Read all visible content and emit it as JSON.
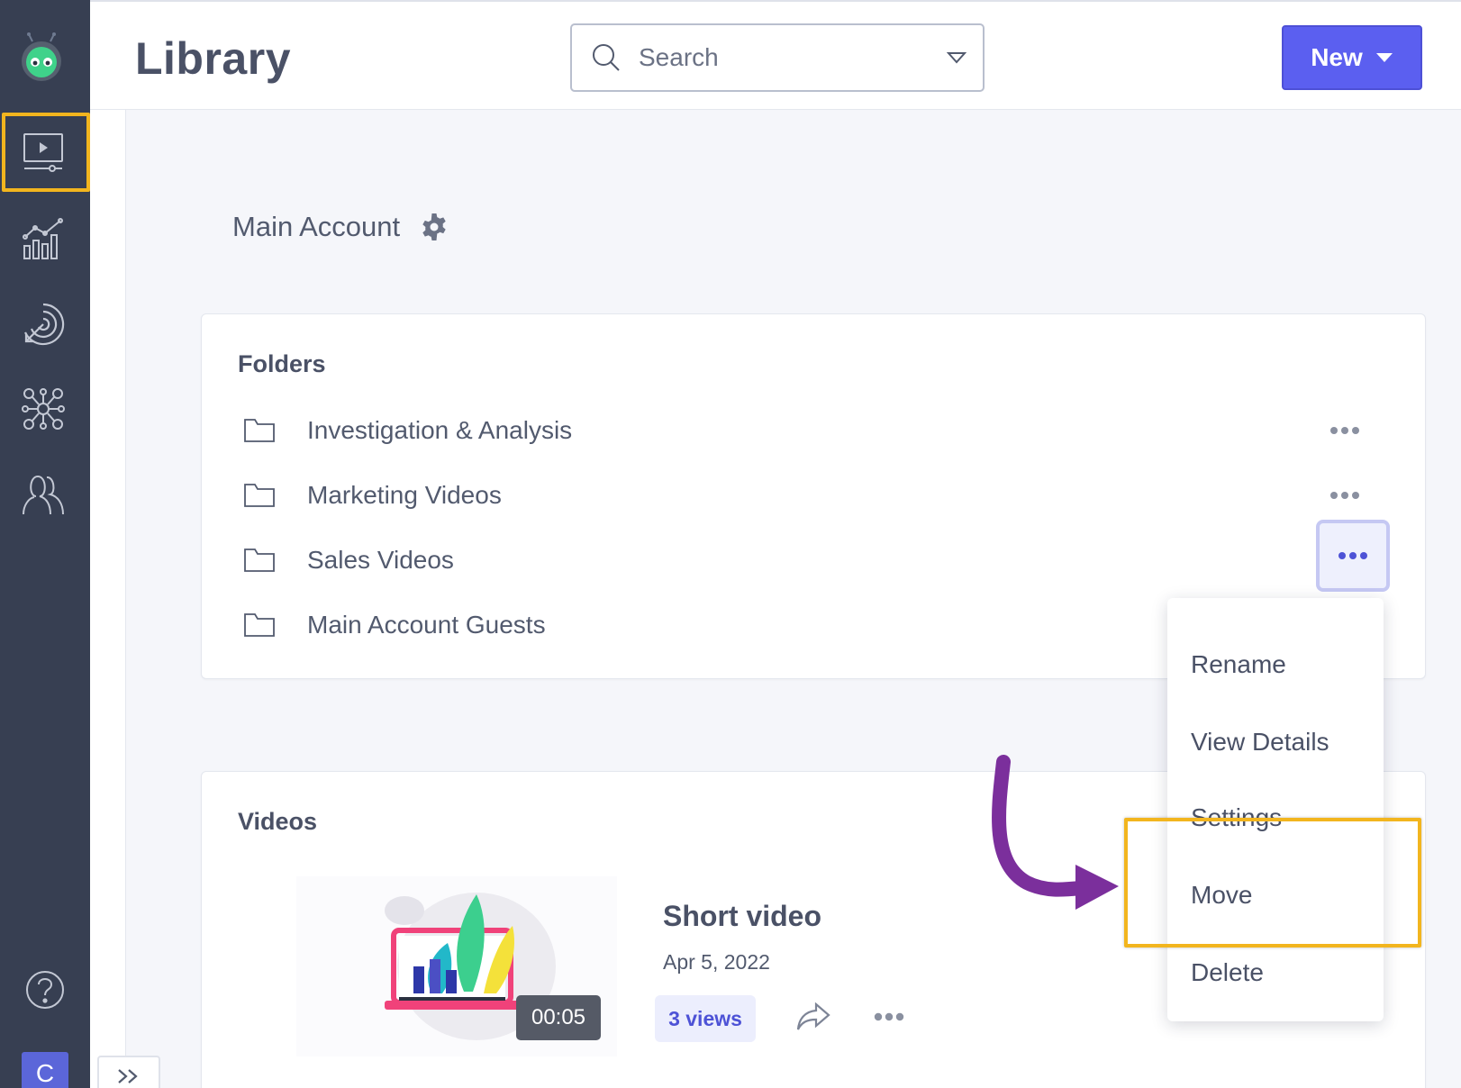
{
  "header": {
    "title": "Library",
    "search_placeholder": "Search",
    "new_label": "New"
  },
  "sidebar": {
    "items": [
      {
        "icon": "video-library-icon",
        "active": true
      },
      {
        "icon": "analytics-icon"
      },
      {
        "icon": "engagement-target-icon"
      },
      {
        "icon": "integrations-network-icon"
      },
      {
        "icon": "users-icon"
      }
    ],
    "help_icon": "question-circle-icon",
    "avatar_initial": "C"
  },
  "account": {
    "name": "Main Account"
  },
  "folders": {
    "title": "Folders",
    "items": [
      {
        "name": "Investigation & Analysis"
      },
      {
        "name": "Marketing Videos"
      },
      {
        "name": "Sales Videos"
      },
      {
        "name": "Main Account Guests"
      }
    ]
  },
  "context_menu": {
    "items": [
      "Rename",
      "View Details",
      "Settings",
      "Move",
      "Delete"
    ],
    "highlighted": "Move"
  },
  "videos": {
    "title": "Videos",
    "items": [
      {
        "title": "Short video",
        "date": "Apr 5, 2022",
        "views": "3 views",
        "duration": "00:05"
      }
    ]
  },
  "colors": {
    "sidebar_bg": "#373f52",
    "primary": "#5b5ff0",
    "highlight": "#f2b51e",
    "arrow": "#7b2f9c"
  }
}
